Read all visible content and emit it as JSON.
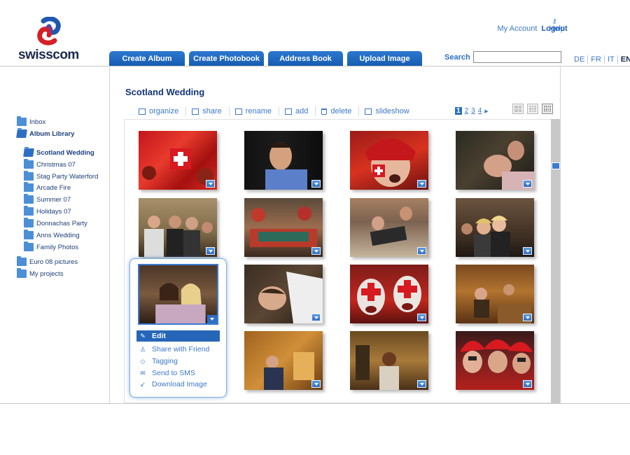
{
  "brand": {
    "name": "swisscom"
  },
  "header": {
    "links": [
      "My Account",
      "Help"
    ],
    "logout": "Logout",
    "tabs": [
      "Create Album",
      "Create Photobook",
      "Address Book",
      "Upload Image"
    ],
    "search_label": "Search",
    "search_value": "",
    "languages": [
      "DE",
      "FR",
      "IT",
      "EN"
    ],
    "active_language": "EN"
  },
  "sidebar": {
    "items": [
      {
        "label": "Inbox"
      },
      {
        "label": "Album Library"
      },
      {
        "label": "Scotland Wedding"
      },
      {
        "label": "Christmas 07"
      },
      {
        "label": "Stag Party Waterford"
      },
      {
        "label": "Arcade Fire"
      },
      {
        "label": "Summer 07"
      },
      {
        "label": "Holidays 07"
      },
      {
        "label": "Donnachas Party"
      },
      {
        "label": "Anns Wedding"
      },
      {
        "label": "Family Photos"
      },
      {
        "label": "Euro 08 pictures"
      },
      {
        "label": "My projects"
      }
    ]
  },
  "album": {
    "title": "Scotland Wedding",
    "toolbar": [
      "organize",
      "share",
      "rename",
      "add",
      "delete",
      "slideshow"
    ],
    "pages": [
      "1",
      "2",
      "3",
      "4"
    ],
    "current_page": "1"
  },
  "context_menu": {
    "items": [
      "Edit",
      "Share with Friend",
      "Tagging",
      "Send to SMS",
      "Download Image"
    ]
  },
  "colors": {
    "accent": "#2d6fc4",
    "tab": "#1d63b8",
    "link": "#3c78c8"
  }
}
